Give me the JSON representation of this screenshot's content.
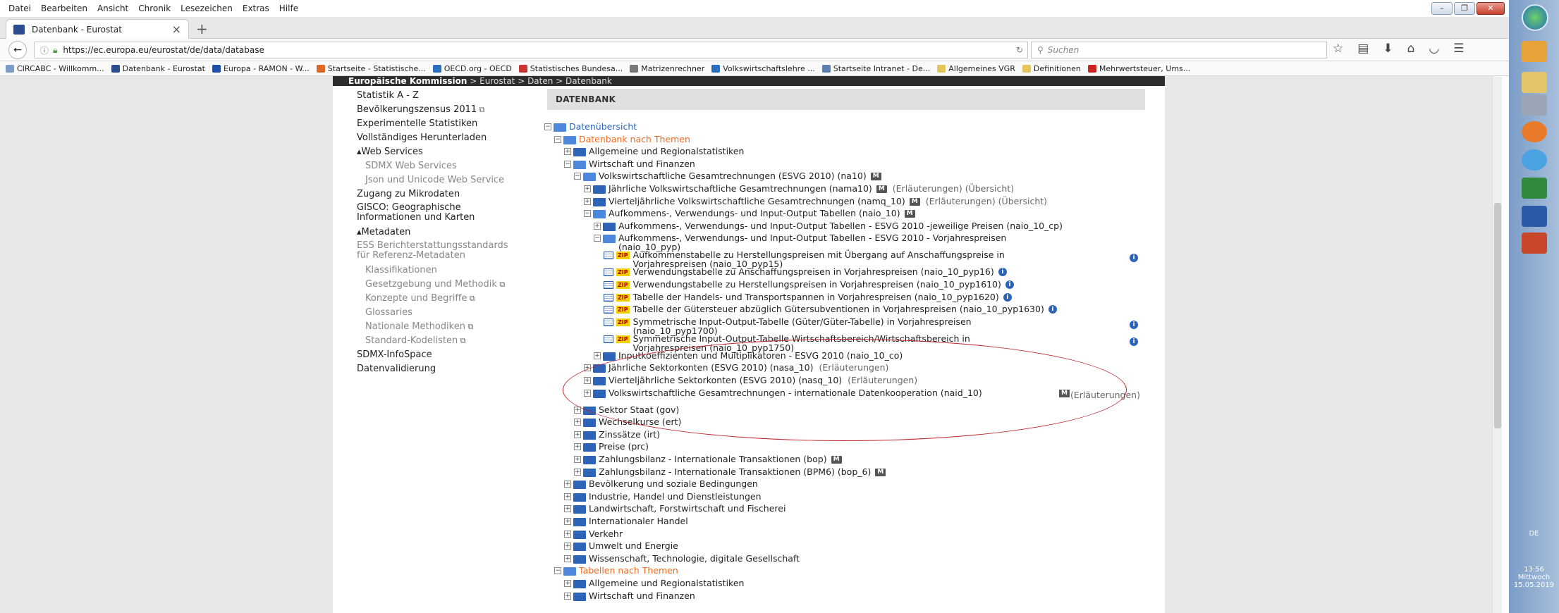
{
  "menubar": {
    "items": [
      "Datei",
      "Bearbeiten",
      "Ansicht",
      "Chronik",
      "Lesezeichen",
      "Extras",
      "Hilfe"
    ]
  },
  "tab": {
    "title": "Datenbank - Eurostat"
  },
  "address": {
    "url": "https://ec.europa.eu/eurostat/de/data/database",
    "search_placeholder": "Suchen"
  },
  "bookmarks": [
    "CIRCABC - Willkomm...",
    "Datenbank - Eurostat",
    "Europa - RAMON - W...",
    "Startseite - Statistische...",
    "OECD.org - OECD",
    "Statistisches Bundesa...",
    "Matrizenrechner",
    "Volkswirtschaftslehre ...",
    "Startseite Intranet - De...",
    "Allgemeines VGR",
    "Definitionen",
    "Mehrwertsteuer, Ums..."
  ],
  "eurostat": {
    "header_org": "Europäische Kommission",
    "breadcrumb": "> Eurostat > Daten > Datenbank",
    "db_title": "DATENBANK"
  },
  "leftnav": [
    {
      "label": "Statistik A - Z",
      "style": "dark"
    },
    {
      "label": "Bevölkerungszensus 2011",
      "style": "dark",
      "ext": true
    },
    {
      "label": "Experimentelle Statistiken",
      "style": "dark"
    },
    {
      "label": "Vollständiges Herunterladen",
      "style": "dark"
    },
    {
      "label": "▴Web Services",
      "style": "sec"
    },
    {
      "label": "SDMX Web Services",
      "style": "grey"
    },
    {
      "label": "Json und Unicode Web Service",
      "style": "grey"
    },
    {
      "label": "Zugang zu Mikrodaten",
      "style": "dark"
    },
    {
      "label": "GISCO: Geographische Informationen und Karten",
      "style": "dark"
    },
    {
      "label": "▴Metadaten",
      "style": "sec"
    },
    {
      "label": "ESS Berichterstattungsstandards für Referenz-Metadaten",
      "style": "grey"
    },
    {
      "label": "Klassifikationen",
      "style": "grey"
    },
    {
      "label": "Gesetzgebung und Methodik",
      "style": "grey",
      "ext": true
    },
    {
      "label": "Konzepte und Begriffe",
      "style": "grey",
      "ext": true
    },
    {
      "label": "Glossaries",
      "style": "grey"
    },
    {
      "label": "Nationale Methodiken",
      "style": "grey",
      "ext": true
    },
    {
      "label": "Standard-Kodelisten",
      "style": "grey",
      "ext": true
    },
    {
      "label": "SDMX-InfoSpace",
      "style": "dark"
    },
    {
      "label": "Datenvalidierung",
      "style": "dark"
    }
  ],
  "tree": [
    {
      "level": 0,
      "kind": "folder",
      "open": true,
      "color": "blue",
      "label": "Datenübersicht"
    },
    {
      "level": 1,
      "kind": "folder",
      "open": true,
      "color": "orange",
      "label": "Datenbank nach Themen"
    },
    {
      "level": 2,
      "kind": "folder",
      "label": "Allgemeine und Regionalstatistiken"
    },
    {
      "level": 2,
      "kind": "folder",
      "open": true,
      "label": "Wirtschaft und Finanzen"
    },
    {
      "level": 3,
      "kind": "folder",
      "open": true,
      "label": "Volkswirtschaftliche Gesamtrechnungen (ESVG 2010) (na10)",
      "m": true
    },
    {
      "level": 4,
      "kind": "folder",
      "label": "Jährliche Volkswirtschaftliche Gesamtrechnungen (nama10)",
      "m": true,
      "extra": "(Erläuterungen) (Übersicht)"
    },
    {
      "level": 4,
      "kind": "folder",
      "label": "Vierteljährliche Volkswirtschaftliche Gesamtrechnungen (namq_10)",
      "m": true,
      "extra": "(Erläuterungen) (Übersicht)"
    },
    {
      "level": 4,
      "kind": "folder",
      "open": true,
      "label": "Aufkommens-, Verwendungs- und Input-Output Tabellen (naio_10)",
      "m": true
    },
    {
      "level": 5,
      "kind": "folder",
      "label": "Aufkommens-, Verwendungs- und Input-Output Tabellen - ESVG 2010 -jeweilige Preisen (naio_10_cp)"
    },
    {
      "level": 5,
      "kind": "folder",
      "open": true,
      "label": "Aufkommens-, Verwendungs- und Input-Output Tabellen - ESVG 2010 - Vorjahrespreisen (naio_10_pyp)",
      "wrap": true
    },
    {
      "level": 6,
      "kind": "table",
      "label": "Aufkommenstabelle zu Herstellungspreisen mit Übergang auf Anschaffungspreise in Vorjahrespreisen (naio_10_pyp15)",
      "wrap": true,
      "info": "far"
    },
    {
      "level": 6,
      "kind": "table",
      "label": "Verwendungstabelle zu Anschaffungspreisen in Vorjahrespreisen (naio_10_pyp16)",
      "info": "near"
    },
    {
      "level": 6,
      "kind": "table",
      "label": "Verwendungstabelle zu Herstellungspreisen in Vorjahrespreisen (naio_10_pyp1610)",
      "info": "near"
    },
    {
      "level": 6,
      "kind": "table",
      "label": "Tabelle der Handels- und Transportspannen in Vorjahrespreisen (naio_10_pyp1620)",
      "info": "near"
    },
    {
      "level": 6,
      "kind": "table",
      "label": "Tabelle der Gütersteuer abzüglich Gütersubventionen in Vorjahrespreisen (naio_10_pyp1630)",
      "info": "near"
    },
    {
      "level": 6,
      "kind": "table",
      "label": "Symmetrische Input-Output-Tabelle (Güter/Güter-Tabelle) in Vorjahrespreisen (naio_10_pyp1700)",
      "wrap": true,
      "info": "far"
    },
    {
      "level": 6,
      "kind": "table",
      "label": "Symmetrische Input-Output-Tabelle Wirtschaftsbereich/Wirtschaftsbereich in Vorjahrespreisen (naio_10_pyp1750)",
      "wrap": true,
      "info": "far"
    },
    {
      "level": 5,
      "kind": "folder",
      "label": "Inputkoeffizienten und Multiplikatoren - ESVG 2010 (naio_10_co)"
    },
    {
      "level": 4,
      "kind": "folder",
      "label": "Jährliche Sektorkonten (ESVG 2010) (nasa_10)",
      "extra": "(Erläuterungen)"
    },
    {
      "level": 4,
      "kind": "folder",
      "label": "Vierteljährliche Sektorkonten (ESVG 2010) (nasq_10)",
      "extra": "(Erläuterungen)"
    },
    {
      "level": 4,
      "kind": "folder",
      "label": "Volkswirtschaftliche Gesamtrechnungen - internationale Datenkooperation (naid_10)",
      "wrap": true,
      "mright": true,
      "extra": "(Erläuterungen)"
    },
    {
      "level": 3,
      "kind": "folder",
      "label": "Sektor Staat (gov)"
    },
    {
      "level": 3,
      "kind": "folder",
      "label": "Wechselkurse (ert)"
    },
    {
      "level": 3,
      "kind": "folder",
      "label": "Zinssätze (irt)"
    },
    {
      "level": 3,
      "kind": "folder",
      "label": "Preise (prc)"
    },
    {
      "level": 3,
      "kind": "folder",
      "label": "Zahlungsbilanz - Internationale Transaktionen (bop)",
      "m": true
    },
    {
      "level": 3,
      "kind": "folder",
      "label": "Zahlungsbilanz - Internationale Transaktionen (BPM6) (bop_6)",
      "m": true
    },
    {
      "level": 2,
      "kind": "folder",
      "label": "Bevölkerung und soziale Bedingungen"
    },
    {
      "level": 2,
      "kind": "folder",
      "label": "Industrie, Handel und Dienstleistungen"
    },
    {
      "level": 2,
      "kind": "folder",
      "label": "Landwirtschaft, Forstwirtschaft und Fischerei"
    },
    {
      "level": 2,
      "kind": "folder",
      "label": "Internationaler Handel"
    },
    {
      "level": 2,
      "kind": "folder",
      "label": "Verkehr"
    },
    {
      "level": 2,
      "kind": "folder",
      "label": "Umwelt und Energie"
    },
    {
      "level": 2,
      "kind": "folder",
      "label": "Wissenschaft, Technologie, digitale Gesellschaft"
    },
    {
      "level": 1,
      "kind": "folder",
      "open": true,
      "color": "orange",
      "label": "Tabellen nach Themen"
    },
    {
      "level": 2,
      "kind": "folder",
      "label": "Allgemeine und Regionalstatistiken"
    },
    {
      "level": 2,
      "kind": "folder",
      "label": "Wirtschaft und Finanzen"
    }
  ],
  "labels": {
    "m": "M",
    "zip": "ZIP",
    "info": "i"
  },
  "tray": {
    "lang": "DE",
    "time": "13:56",
    "day": "Mittwoch",
    "date": "15.05.2019"
  }
}
